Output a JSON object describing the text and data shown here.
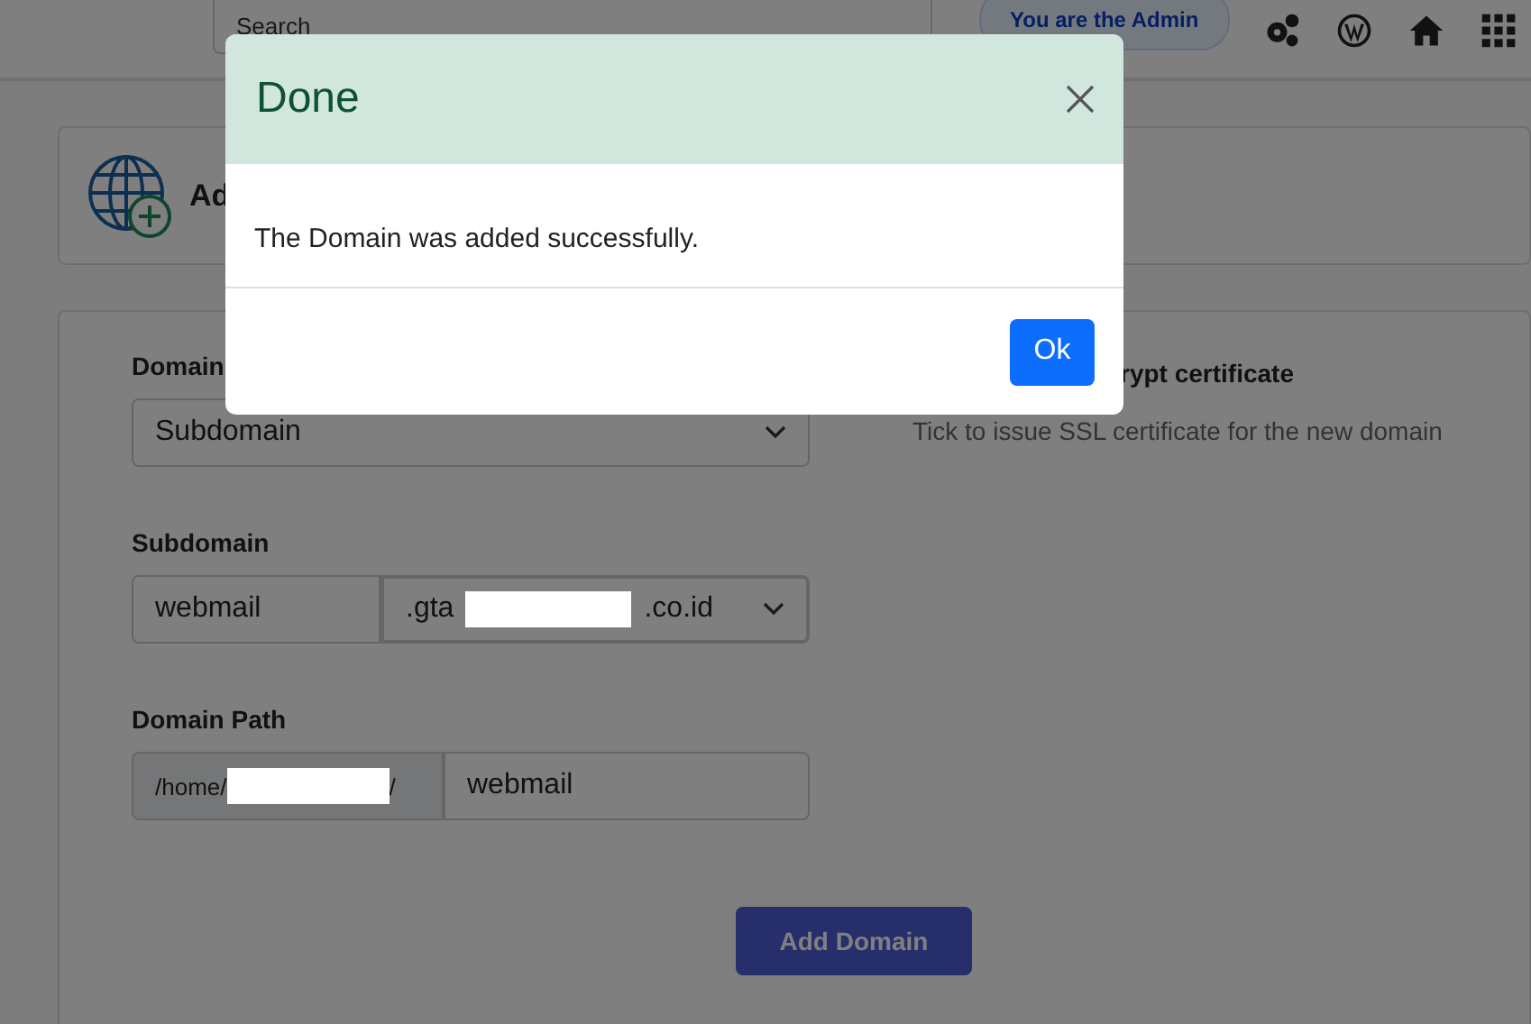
{
  "topbar": {
    "search": {
      "placeholder": "Search"
    },
    "admin_badge": "You are the Admin"
  },
  "header": {
    "title": "Ad"
  },
  "form": {
    "domain_type": {
      "label": "Domain",
      "value": "Subdomain"
    },
    "subdomain": {
      "label": "Subdomain",
      "value": "webmail",
      "suffix_start": ".gta",
      "suffix_end": ".co.id"
    },
    "domain_path": {
      "label": "Domain Path",
      "prefix_start": "/home/",
      "prefix_end": "/",
      "value": "webmail"
    },
    "ssl": {
      "title": "rypt certificate",
      "hint": "Tick to issue SSL certificate for the new domain"
    },
    "submit": "Add Domain"
  },
  "modal": {
    "title": "Done",
    "message": "The Domain was added successfully.",
    "ok": "Ok"
  }
}
